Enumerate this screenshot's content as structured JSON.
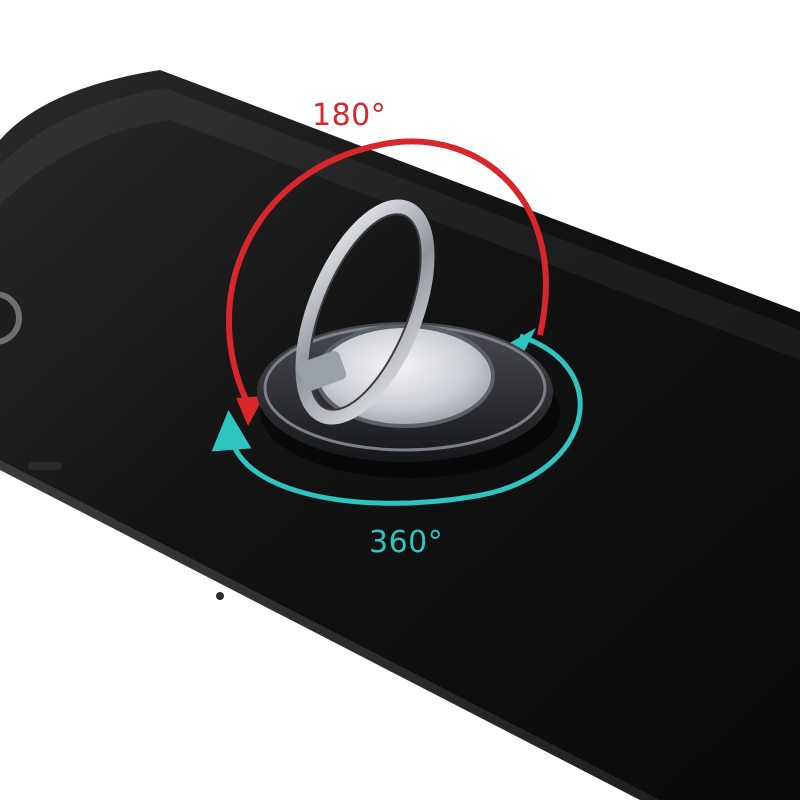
{
  "labels": {
    "top_rotation": "180°",
    "bottom_rotation": "360°"
  },
  "colors": {
    "background": "#ffffff",
    "phone_body": "#141414",
    "arrow_red": "#d8262a",
    "arrow_cyan": "#2ec4c0",
    "ring_metal": "#c9ccd1",
    "base_metal": "#2b2d31"
  },
  "icons": {
    "top_arrow": "curved-arrow-180-icon",
    "bottom_arrow": "circular-arrow-360-icon"
  }
}
